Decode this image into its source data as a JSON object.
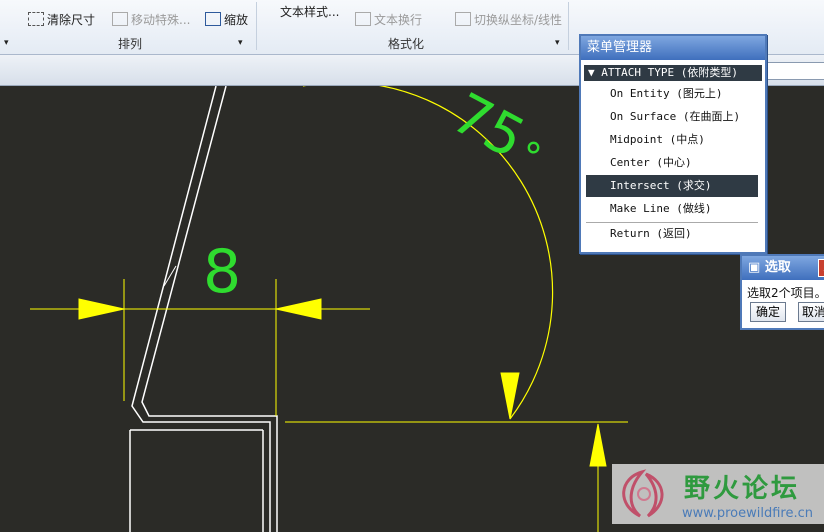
{
  "ribbon": {
    "row1": {
      "item1": "清除尺寸",
      "item2": "移动特殊...",
      "item3": "缩放",
      "item4": "文本样式...",
      "item5": "文本换行",
      "item6": "切换纵坐标/线性"
    },
    "groups": {
      "arrange": "排列",
      "format": "格式化"
    }
  },
  "drawing": {
    "dim_8": "8",
    "dim_75": "75",
    "degree_symbol": "°"
  },
  "menu_manager": {
    "title": "菜单管理器",
    "header": "ATTACH TYPE (依附类型)",
    "items": [
      "On Entity (图元上)",
      "On Surface (在曲面上)",
      "Midpoint (中点)",
      "Center (中心)",
      "Intersect (求交)",
      "Make Line (做线)",
      "Return (返回)"
    ],
    "selected_index": 4
  },
  "select_dialog": {
    "title": "选取",
    "message": "选取2个项目。",
    "ok": "确定",
    "cancel": "取消",
    "close": "X"
  },
  "watermark": {
    "text": "野火论坛",
    "url": "www.proewildfire.cn"
  },
  "colors": {
    "dimension": "#ffff00",
    "dim_text": "#2fdc2f",
    "geometry": "#ffffff",
    "background": "#2b2b27",
    "menu_title": "#3f6fbd"
  }
}
